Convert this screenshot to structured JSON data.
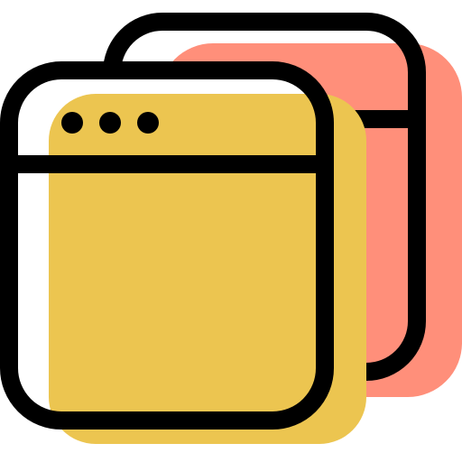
{
  "icon": {
    "name": "multiple-windows-icon",
    "description_visible_text": ""
  },
  "colors": {
    "outline": "#000000",
    "back_window_fill": "#FF8F7A",
    "front_window_fill": "#ECC550",
    "background": "#FFFFFF"
  }
}
